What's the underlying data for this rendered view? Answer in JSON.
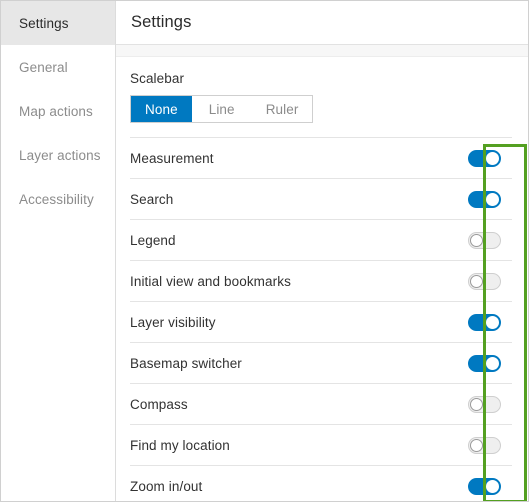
{
  "sidebar": {
    "items": [
      {
        "label": "Settings",
        "active": true
      },
      {
        "label": "General",
        "active": false
      },
      {
        "label": "Map actions",
        "active": false
      },
      {
        "label": "Layer actions",
        "active": false
      },
      {
        "label": "Accessibility",
        "active": false
      }
    ]
  },
  "header": {
    "title": "Settings"
  },
  "scalebar": {
    "label": "Scalebar",
    "options": [
      {
        "label": "None",
        "selected": true
      },
      {
        "label": "Line",
        "selected": false
      },
      {
        "label": "Ruler",
        "selected": false
      }
    ]
  },
  "rows": [
    {
      "label": "Measurement",
      "state": "on"
    },
    {
      "label": "Search",
      "state": "on"
    },
    {
      "label": "Legend",
      "state": "off"
    },
    {
      "label": "Initial view and bookmarks",
      "state": "off"
    },
    {
      "label": "Layer visibility",
      "state": "on"
    },
    {
      "label": "Basemap switcher",
      "state": "on"
    },
    {
      "label": "Compass",
      "state": "off"
    },
    {
      "label": "Find my location",
      "state": "off"
    },
    {
      "label": "Zoom in/out",
      "state": "on"
    }
  ],
  "colors": {
    "accent": "#0079c1",
    "highlight": "#54a021",
    "sidebar_active_bg": "#e7e7e7",
    "toggle_off_track": "#efefef",
    "divider": "#e4e4e4",
    "text": "#323232",
    "text_muted": "#8c8c8c"
  }
}
